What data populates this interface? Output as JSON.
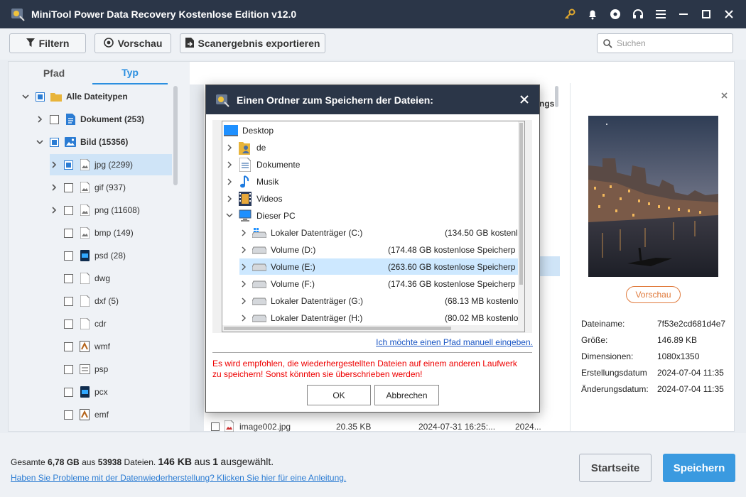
{
  "window": {
    "title": "MiniTool Power Data Recovery Kostenlose Edition v12.0",
    "icons": [
      "key-icon",
      "bell-icon",
      "disc-icon",
      "headset-icon",
      "menu-icon",
      "minimize-icon",
      "maximize-icon",
      "close-icon"
    ]
  },
  "toolbar": {
    "filter_label": "Filtern",
    "preview_label": "Vorschau",
    "export_label": "Scanergebnis exportieren",
    "search_placeholder": "Suchen"
  },
  "left_tabs": [
    "Pfad",
    "Typ"
  ],
  "tree": [
    {
      "label": "Alle Dateitypen",
      "bold": true,
      "icon": "folder-icon"
    },
    {
      "label": "Dokument (253)",
      "bold": true,
      "icon": "document-icon"
    },
    {
      "label": "Bild (15356)",
      "bold": true,
      "icon": "image-icon"
    },
    {
      "label": "jpg (2299)",
      "icon": "image-icon"
    },
    {
      "label": "gif (937)",
      "icon": "image-icon"
    },
    {
      "label": "png (11608)",
      "icon": "image-icon"
    },
    {
      "label": "bmp (149)",
      "icon": "image-icon"
    },
    {
      "label": "psd (28)",
      "icon": "psd-icon"
    },
    {
      "label": "dwg",
      "icon": "file-icon"
    },
    {
      "label": "dxf (5)",
      "icon": "file-icon"
    },
    {
      "label": "cdr",
      "icon": "file-icon"
    },
    {
      "label": "wmf",
      "icon": "wmf-icon"
    },
    {
      "label": "psp",
      "icon": "psp-icon"
    },
    {
      "label": "pcx",
      "icon": "pcx-icon"
    },
    {
      "label": "emf",
      "icon": "emf-icon"
    }
  ],
  "file_list": {
    "header_fragment": "ngs",
    "visible_row": {
      "name": "image002.jpg",
      "size": "20.35 KB",
      "created": "2024-07-31 16:25:...",
      "modified": "2024..."
    }
  },
  "preview": {
    "button_label": "Vorschau",
    "meta": [
      {
        "label": "Dateiname:",
        "value": "7f53e2cd681d4e7"
      },
      {
        "label": "Größe:",
        "value": "146.89 KB"
      },
      {
        "label": "Dimensionen:",
        "value": "1080x1350"
      },
      {
        "label": "Erstellungsdatum",
        "value": "2024-07-04 11:35"
      },
      {
        "label": "Änderungsdatum:",
        "value": "2024-07-04 11:35"
      }
    ]
  },
  "bottom": {
    "summary_prefix": "Gesamte",
    "summary_total": "6,78 GB",
    "summary_mid": "aus",
    "summary_files": "53938",
    "summary_files_suffix": "Dateien.",
    "summary_selected_size": "146 KB",
    "summary_selected_mid": "aus",
    "summary_selected_count": "1",
    "summary_selected_suffix": "ausgewählt.",
    "help_link": "Haben Sie Probleme mit der Datenwiederherstellung? Klicken Sie hier für eine Anleitung.",
    "home_button": "Startseite",
    "save_button": "Speichern"
  },
  "dialog": {
    "title": "Einen Ordner zum Speichern der Dateien:",
    "folders": [
      {
        "label": "Desktop",
        "icon": "desktop-icon",
        "space": ""
      },
      {
        "label": "de",
        "icon": "user-folder-icon",
        "space": ""
      },
      {
        "label": "Dokumente",
        "icon": "documents-icon",
        "space": ""
      },
      {
        "label": "Musik",
        "icon": "music-icon",
        "space": ""
      },
      {
        "label": "Videos",
        "icon": "videos-icon",
        "space": ""
      },
      {
        "label": "Dieser PC",
        "icon": "pc-icon",
        "space": ""
      },
      {
        "label": "Lokaler Datenträger (C:)",
        "icon": "drive-system-icon",
        "space": "(134.50 GB kostenlo"
      },
      {
        "label": "Volume (D:)",
        "icon": "drive-icon",
        "space": "(174.48 GB kostenlose Speicherp"
      },
      {
        "label": "Volume (E:)",
        "icon": "drive-icon",
        "space": "(263.60 GB kostenlose Speicherp"
      },
      {
        "label": "Volume (F:)",
        "icon": "drive-icon",
        "space": "(174.36 GB kostenlose Speicherp"
      },
      {
        "label": "Lokaler Datenträger (G:)",
        "icon": "drive-icon",
        "space": "(68.13 MB kostenlo"
      },
      {
        "label": "Lokaler Datenträger (H:)",
        "icon": "drive-icon",
        "space": "(80.02 MB kostenlo"
      }
    ],
    "manual_link": "Ich möchte einen Pfad manuell eingeben.",
    "warning_line1": "Es wird empfohlen, die wiederhergestellten Dateien auf einem anderen Laufwerk",
    "warning_line2": "zu speichern! Sonst könnten sie überschrieben werden!",
    "ok_label": "OK",
    "cancel_label": "Abbrechen"
  },
  "colors": {
    "titlebar": "#2b3648",
    "accent": "#3a9ae0",
    "warning": "#ee0000",
    "preview_outline": "#e07a3c"
  }
}
